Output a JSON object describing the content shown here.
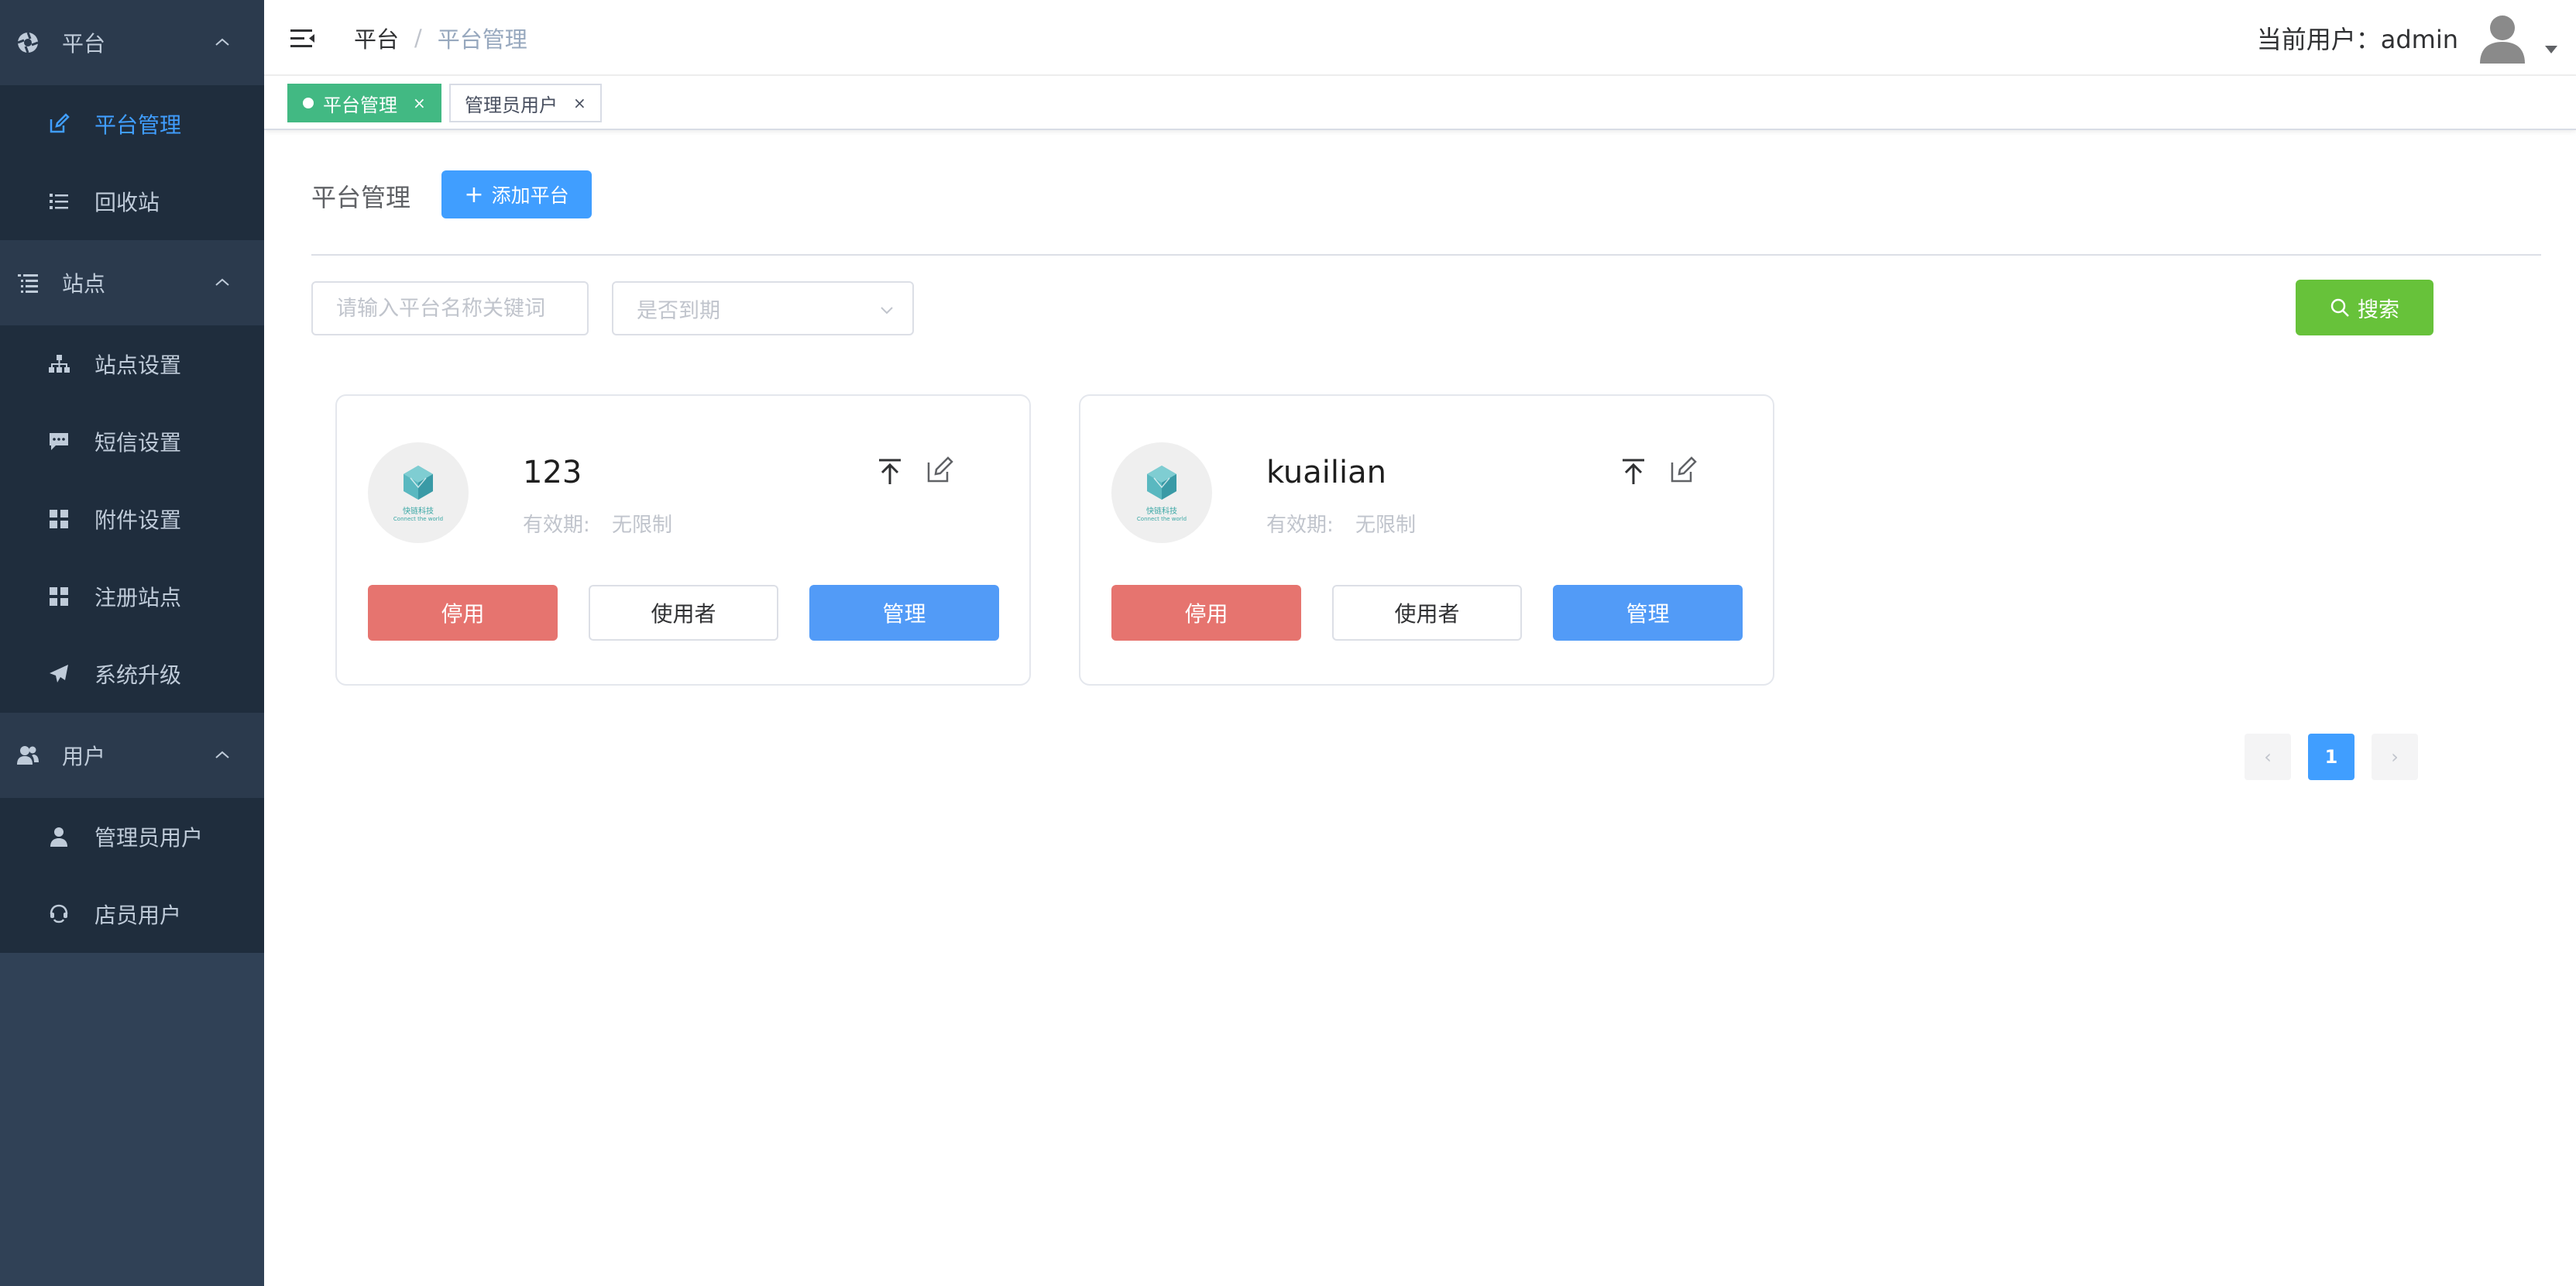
{
  "sidebar": {
    "groups": [
      {
        "label": "平台",
        "icon": "aperture-icon",
        "items": [
          {
            "label": "平台管理",
            "icon": "edit-icon",
            "active": true
          },
          {
            "label": "回收站",
            "icon": "list-icon",
            "active": false
          }
        ]
      },
      {
        "label": "站点",
        "icon": "list-indent-icon",
        "items": [
          {
            "label": "站点设置",
            "icon": "sitemap-icon"
          },
          {
            "label": "短信设置",
            "icon": "message-icon"
          },
          {
            "label": "附件设置",
            "icon": "grid-icon"
          },
          {
            "label": "注册站点",
            "icon": "grid-icon"
          },
          {
            "label": "系统升级",
            "icon": "paper-plane-icon"
          }
        ]
      },
      {
        "label": "用户",
        "icon": "users-icon",
        "items": [
          {
            "label": "管理员用户",
            "icon": "user-icon"
          },
          {
            "label": "店员用户",
            "icon": "staff-icon"
          }
        ]
      }
    ]
  },
  "header": {
    "breadcrumb": [
      "平台",
      "平台管理"
    ],
    "breadcrumb_separator": "/",
    "user_label": "当前用户：admin"
  },
  "tags": [
    {
      "label": "平台管理",
      "active": true,
      "close": "×"
    },
    {
      "label": "管理员用户",
      "active": false,
      "close": "×"
    }
  ],
  "main": {
    "title": "平台管理",
    "add_button": "添加平台",
    "add_button_icon": "+",
    "search_placeholder": "请输入平台名称关键词",
    "expire_select_placeholder": "是否到期",
    "search_button": "搜索"
  },
  "cards": [
    {
      "name": "123",
      "validity_label": "有效期:",
      "validity_value": "无限制",
      "logo_cn": "快链科技",
      "logo_en": "Connect the world",
      "btn_disable": "停用",
      "btn_users": "使用者",
      "btn_manage": "管理"
    },
    {
      "name": "kuailian",
      "validity_label": "有效期:",
      "validity_value": "无限制",
      "logo_cn": "快链科技",
      "logo_en": "Connect the world",
      "btn_disable": "停用",
      "btn_users": "使用者",
      "btn_manage": "管理"
    }
  ],
  "pagination": {
    "current_page": "1",
    "prev": "‹",
    "next": "›"
  },
  "colors": {
    "sidebar_bg": "#304156",
    "submenu_bg": "#1f2d3d",
    "active_menu": "#409eff",
    "tag_active": "#42b983",
    "primary": "#409eff",
    "success": "#67c23a",
    "danger": "#e6746f"
  }
}
